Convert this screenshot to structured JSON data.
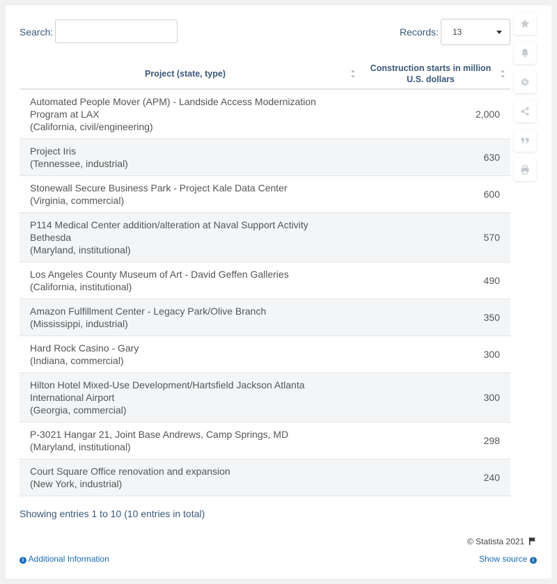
{
  "controls": {
    "search_label": "Search:",
    "search_value": "",
    "records_label": "Records:",
    "records_value": "13"
  },
  "table": {
    "headers": [
      "Project (state, type)",
      "Construction starts in million U.S. dollars"
    ],
    "rows": [
      {
        "project": "Automated People Mover (APM) - Landside Access Modernization Program at LAX",
        "meta": "(California, civil/engineering)",
        "value": "2,000"
      },
      {
        "project": "Project Iris",
        "meta": "(Tennessee, industrial)",
        "value": "630"
      },
      {
        "project": "Stonewall Secure Business Park - Project Kale Data Center",
        "meta": "(Virginia, commercial)",
        "value": "600"
      },
      {
        "project": "P114 Medical Center addition/alteration at Naval Support Activity Bethesda",
        "meta": "(Maryland, institutional)",
        "value": "570"
      },
      {
        "project": "Los Angeles County Museum of Art - David Geffen Galleries",
        "meta": "(California, institutional)",
        "value": "490"
      },
      {
        "project": "Amazon Fulfillment Center - Legacy Park/Olive Branch",
        "meta": "(Mississippi, industrial)",
        "value": "350"
      },
      {
        "project": "Hard Rock Casino - Gary",
        "meta": "(Indiana, commercial)",
        "value": "300"
      },
      {
        "project": "Hilton Hotel Mixed-Use Development/Hartsfield Jackson Atlanta International Airport",
        "meta": "(Georgia, commercial)",
        "value": "300"
      },
      {
        "project": "P-3021 Hangar 21, Joint Base Andrews, Camp Springs, MD",
        "meta": "(Maryland, institutional)",
        "value": "298"
      },
      {
        "project": "Court Square Office renovation and expansion",
        "meta": "(New York, industrial)",
        "value": "240"
      }
    ]
  },
  "footer": {
    "info": "Showing entries 1 to 10 (10 entries in total)",
    "copyright": "© Statista 2021",
    "additional_info": "Additional Information",
    "show_source": "Show source"
  },
  "sidebar_icons": [
    "star-icon",
    "bell-icon",
    "gear-icon",
    "share-icon",
    "quote-icon",
    "print-icon"
  ],
  "colors": {
    "link": "#1a6bb5",
    "label": "#3a5878",
    "row_alt": "#f3f5f7"
  }
}
